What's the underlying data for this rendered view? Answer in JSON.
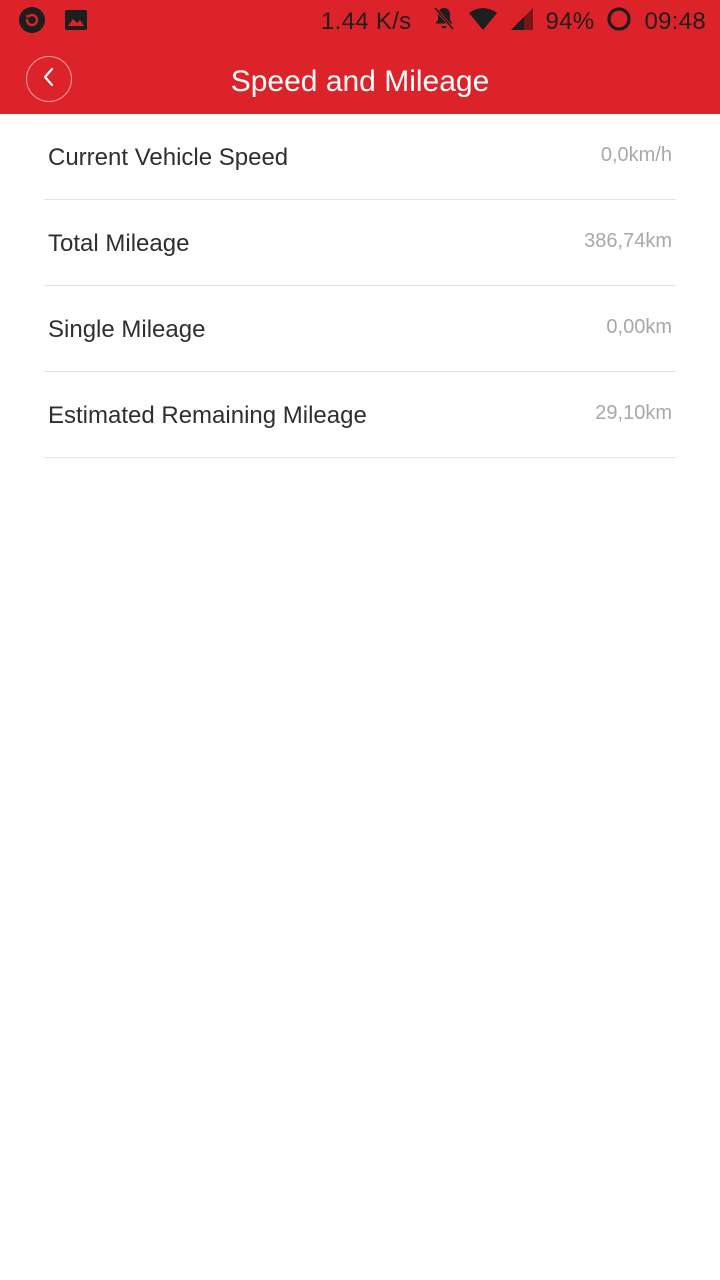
{
  "status_bar": {
    "net_speed": "1.44 K/s",
    "battery": "94%",
    "time": "09:48",
    "icons": [
      "sync-app-icon",
      "image-icon",
      "bell-off-icon",
      "wifi-icon",
      "cell-signal-icon",
      "battery-ring-icon"
    ]
  },
  "header": {
    "title": "Speed and Mileage",
    "back_icon": "chevron-left-icon"
  },
  "rows": [
    {
      "label": "Current Vehicle Speed",
      "value": "0,0km/h"
    },
    {
      "label": "Total Mileage",
      "value": "386,74km"
    },
    {
      "label": "Single Mileage",
      "value": "0,00km"
    },
    {
      "label": "Estimated Remaining Mileage",
      "value": "29,10km"
    }
  ],
  "colors": {
    "accent": "#dc2329",
    "label_text": "#2f2f2f",
    "value_text": "#a8a8a8",
    "divider": "#e3e3e3"
  }
}
